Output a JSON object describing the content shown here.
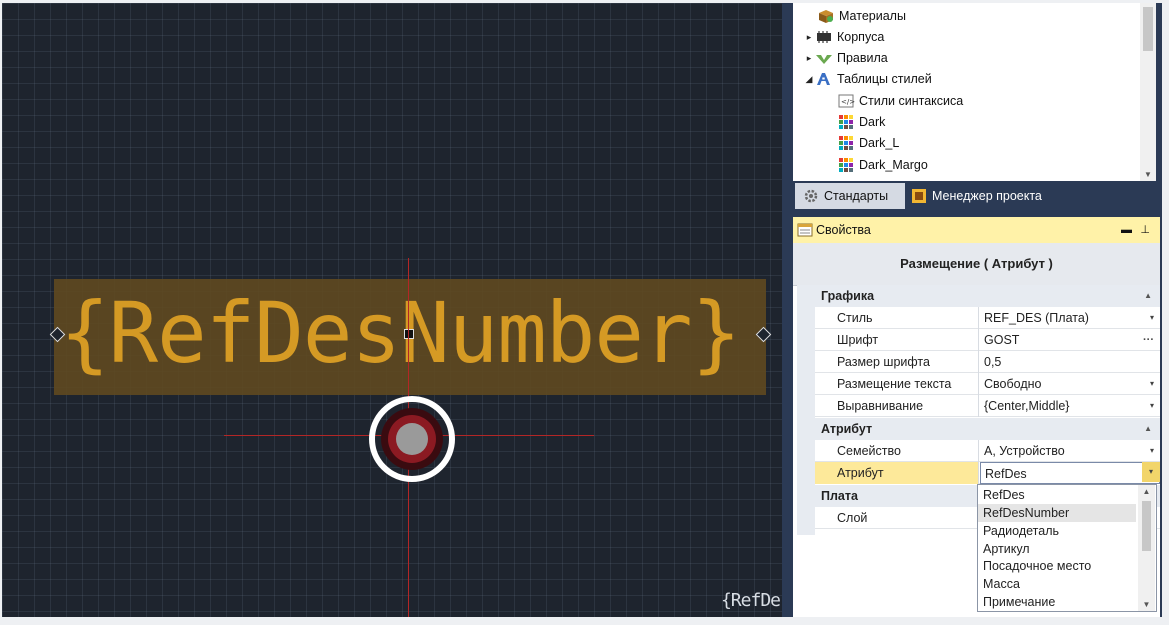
{
  "canvas": {
    "big_label": "{RefDesNumber}",
    "corner_label": "{RefDe"
  },
  "tree": {
    "items": [
      {
        "label": "Материалы",
        "icon": "materials-icon",
        "arrow": "",
        "indent": 1
      },
      {
        "label": "Корпуса",
        "icon": "package-icon",
        "arrow": "▸",
        "indent": 0
      },
      {
        "label": "Правила",
        "icon": "rules-icon",
        "arrow": "▸",
        "indent": 0
      },
      {
        "label": "Таблицы стилей",
        "icon": "stylesheet-icon",
        "arrow": "◢",
        "indent": 0
      },
      {
        "label": "Стили синтаксиса",
        "icon": "syntax-style-icon",
        "arrow": "",
        "indent": 2
      },
      {
        "label": "Dark",
        "icon": "palette-icon",
        "arrow": "",
        "indent": 2
      },
      {
        "label": "Dark_L",
        "icon": "palette-icon",
        "arrow": "",
        "indent": 2
      },
      {
        "label": "Dark_Margo",
        "icon": "palette-icon",
        "arrow": "",
        "indent": 2
      }
    ]
  },
  "tabs": [
    {
      "label": "Стандарты",
      "icon": "gear-icon",
      "active": true
    },
    {
      "label": "Менеджер проекта",
      "icon": "project-manager-icon",
      "active": false
    }
  ],
  "properties": {
    "header": "Свойства",
    "title": "Размещение ( Атрибут )",
    "categories": [
      {
        "name": "Графика",
        "rows": [
          {
            "name": "Стиль",
            "value": "REF_DES (Плата)",
            "control": "▾"
          },
          {
            "name": "Шрифт",
            "value": "GOST",
            "control": "···"
          },
          {
            "name": "Размер шрифта",
            "value": "0,5",
            "control": ""
          },
          {
            "name": "Размещение текста",
            "value": "Свободно",
            "control": "▾"
          },
          {
            "name": "Выравнивание",
            "value": "{Center,Middle}",
            "control": "▾"
          }
        ]
      },
      {
        "name": "Атрибут",
        "rows": [
          {
            "name": "Семейство",
            "value": "А, Устройство",
            "control": "▾"
          },
          {
            "name": "Атрибут",
            "value": "RefDes",
            "control": "▾",
            "selected": true
          }
        ]
      },
      {
        "name": "Плата",
        "rows": [
          {
            "name": "Слой",
            "value": "",
            "control": ""
          }
        ]
      }
    ],
    "dropdown_options": [
      "RefDes",
      "RefDesNumber",
      "Радиодеталь",
      "Артикул",
      "Посадочное место",
      "Масса",
      "Примечание"
    ],
    "dropdown_highlighted": "RefDesNumber"
  },
  "colors": {
    "canvas_bg": "#1e242e",
    "label_orange": "#d59a24",
    "crosshair_red": "#b32626",
    "panel_navy": "#2b3a55",
    "header_yellow": "#fff2a8"
  }
}
